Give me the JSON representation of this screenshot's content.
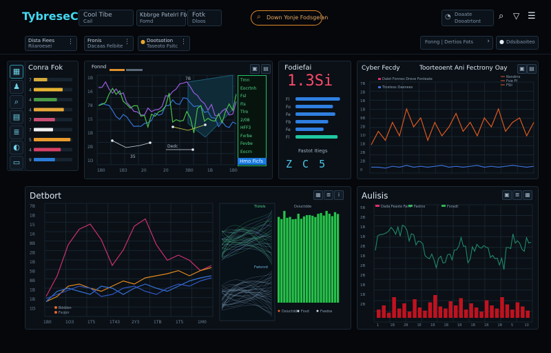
{
  "app": {
    "logo": "TybreseCorty",
    "header_a": {
      "line1": "Cool Tibe",
      "line2": "Cail"
    },
    "header_b": {
      "line1": "Kbbrge Patelrl Fbb",
      "line2": "Fomd"
    },
    "header_c": {
      "line1": "Fotk",
      "line2": "Dloos"
    },
    "search_button": "Down Yonje Fodsgelan",
    "user_box": {
      "line1": "Doaate",
      "line2": "Dooatrtont"
    }
  },
  "toolbar": {
    "select1": {
      "line1": "Dista Fiees",
      "line2": "Riiaroesei"
    },
    "select2": {
      "line1": "Fronis",
      "line2": "Dacaas Felbite"
    },
    "select3": {
      "line1": "Dootsotion",
      "line2": "Taseoto Fsitc"
    },
    "right_text": "Fonng | Dertios Fots",
    "right_label": "Ddsibaoiteo"
  },
  "sidebar_icons": [
    "dashboard-icon",
    "user-icon",
    "search-icon",
    "document-icon",
    "list-icon",
    "analytics-icon",
    "folder-icon"
  ],
  "panel_bars": {
    "title": "Conra Fok",
    "bars": [
      {
        "label": "7",
        "value": 0.35,
        "color": "#d4a93b"
      },
      {
        "label": "4",
        "value": 0.75,
        "color": "#e8b332"
      },
      {
        "label": "4",
        "value": 0.6,
        "color": "#4a9a47"
      },
      {
        "label": "4",
        "value": 0.78,
        "color": "#e7a83a"
      },
      {
        "label": "7",
        "value": 0.55,
        "color": "#c84d73"
      },
      {
        "label": "7",
        "value": 0.5,
        "color": "#f1f1f1"
      },
      {
        "label": "5",
        "value": 0.95,
        "color": "#e99b2d"
      },
      {
        "label": "4",
        "value": 0.7,
        "color": "#d84066"
      },
      {
        "label": "9",
        "value": 0.55,
        "color": "#2b7bd6"
      }
    ]
  },
  "panel_main": {
    "legend": "Fonnd",
    "y_ticks": [
      "1B",
      "16",
      "78",
      "15",
      "1B",
      "2B",
      "1D"
    ],
    "x_ticks": [
      "1B0",
      "1B3",
      "20",
      "20",
      "3B0",
      "1B",
      "1B0"
    ],
    "node_labels": [
      "35",
      "7B",
      "Dedc"
    ],
    "side_list_labels": [
      "Tmn",
      "Eocrtnh",
      "Fsl",
      "Fis",
      "Tlro",
      "2/08",
      "HFF3",
      "Fxrbe",
      "Fevbe",
      "Eocrn"
    ],
    "side_list_selected": "Hmo Ficfs"
  },
  "panel_kpi": {
    "title": "Fodiefai",
    "value": "1.3Si",
    "rows": [
      {
        "label": "Fl",
        "value": 0.95
      },
      {
        "label": "Fo",
        "value": 0.8
      },
      {
        "label": "Fe",
        "value": 0.85
      },
      {
        "label": "Fb",
        "value": 0.7
      },
      {
        "label": "Fe",
        "value": 0.6
      },
      {
        "label": "Fl",
        "value": 0.9
      }
    ],
    "footer": "Fastot Itiegs",
    "digits": "Z C 5"
  },
  "panel_lines": {
    "title": "Cyber Fecdy",
    "subtitle": "Toorteoent Ani Fectrony Oay",
    "legend": [
      "Dalet Fonnes Dreve Fonteate",
      "Tinetess Daenees"
    ],
    "legend_right": [
      "Nondnis",
      "Fsie Ff",
      "FSil"
    ],
    "y_ticks": [
      "7B",
      "2B",
      "1B",
      "1B",
      "9B",
      "2B",
      "1D",
      "1B",
      "2B",
      "2B",
      "0"
    ]
  },
  "panel_bottom": {
    "title": "Detbort",
    "y_ticks": [
      "7B",
      "1B",
      "15",
      "16",
      "8B",
      "2B",
      "1B",
      "5B",
      "8B",
      "1B",
      "1B",
      "1D"
    ],
    "x_ticks": [
      "1B0",
      "1O3",
      "1T5",
      "1T43",
      "2Y3",
      "1TB",
      "1T5",
      "1M0"
    ],
    "legend": [
      "Bdddsn",
      "Fsrjnir"
    ],
    "network_labels": [
      "Tlotols",
      "Fwtsnrd"
    ],
    "green_legend": [
      "Dsiuctdde",
      "Fsvd",
      "Fsedos"
    ]
  },
  "panel_analysis": {
    "title": "Aulisis",
    "legend": [
      "Dada Feaste Fanc",
      "Fastno",
      "Fsnsdt"
    ],
    "y_ticks": [
      "5B",
      "2B",
      "1B",
      "1B",
      "2B",
      "1B",
      "2B",
      "2B",
      "1B",
      "1B",
      "2B"
    ],
    "x_ticks": [
      "1",
      "1B",
      "2B",
      "1E",
      "1B",
      "1B",
      "1B",
      "1B",
      "1B",
      "1B",
      "5",
      "10"
    ]
  },
  "chart_data": [
    {
      "type": "bar",
      "title": "Conra Fok",
      "categories": [
        "7",
        "4",
        "4",
        "4",
        "7",
        "7",
        "5",
        "4",
        "9"
      ],
      "values": [
        0.35,
        0.75,
        0.6,
        0.78,
        0.55,
        0.5,
        0.95,
        0.7,
        0.55
      ]
    },
    {
      "type": "line",
      "title": "Cyber Fecdy",
      "series": [
        {
          "values": [
            30,
            45,
            35,
            55,
            40,
            70,
            50,
            60,
            35,
            55,
            40,
            50,
            65,
            45,
            55,
            40,
            60,
            50,
            70,
            45,
            55,
            60,
            40,
            55
          ]
        },
        {
          "values": [
            5,
            5,
            4,
            6,
            5,
            7,
            5,
            6,
            5,
            6,
            7,
            5,
            6,
            5,
            6,
            7,
            5,
            6,
            5,
            6,
            7,
            6,
            5,
            6
          ]
        }
      ]
    },
    {
      "type": "line",
      "title": "Detbort",
      "series": [
        {
          "values": [
            10,
            30,
            60,
            75,
            80,
            65,
            40,
            55,
            78,
            85,
            60,
            45,
            50,
            45,
            35,
            40
          ]
        },
        {
          "values": [
            5,
            10,
            20,
            22,
            18,
            15,
            20,
            25,
            22,
            28,
            30,
            32,
            35,
            30,
            35,
            38
          ]
        },
        {
          "values": [
            5,
            15,
            18,
            15,
            12,
            20,
            18,
            12,
            18,
            22,
            18,
            15,
            20,
            25,
            28,
            30
          ]
        },
        {
          "values": [
            8,
            12,
            16,
            20,
            18,
            10,
            12,
            18,
            20,
            15,
            12,
            18,
            22,
            20,
            25,
            28
          ]
        }
      ]
    },
    {
      "type": "bar",
      "title": "Aulisis",
      "values": [
        8,
        12,
        5,
        20,
        9,
        14,
        6,
        18,
        10,
        7,
        15,
        22,
        11,
        9,
        16,
        12,
        19,
        8,
        14,
        10,
        6,
        17,
        12,
        9,
        20,
        13,
        8,
        15,
        11,
        7
      ]
    }
  ]
}
